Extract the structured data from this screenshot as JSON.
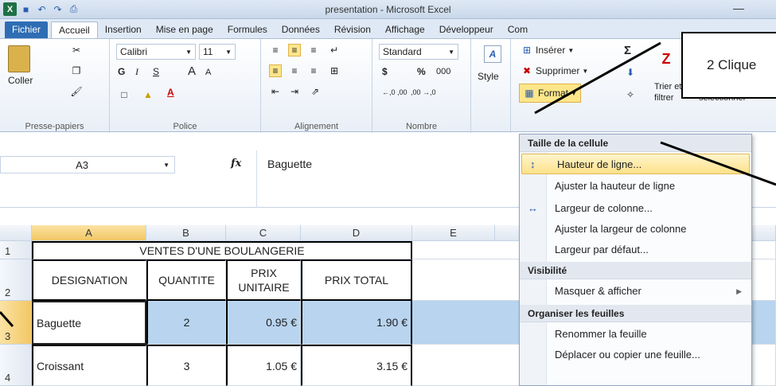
{
  "window": {
    "title": "presentation - Microsoft Excel",
    "minimize_glyph": "—"
  },
  "qat": {
    "logo_letter": "X",
    "save_icon": "save-icon",
    "undo_icon": "undo-icon",
    "redo_icon": "redo-icon"
  },
  "tabs": [
    "Fichier",
    "Accueil",
    "Insertion",
    "Mise en page",
    "Formules",
    "Données",
    "Révision",
    "Affichage",
    "Développeur",
    "Com"
  ],
  "ribbon": {
    "clipboard": {
      "paste": "Coller",
      "group": "Presse-papiers"
    },
    "font": {
      "name": "Calibri",
      "size": "11",
      "bold": "G",
      "italic": "I",
      "underline": "S",
      "grow": "A",
      "shrink": "A",
      "fontcolor": "A",
      "group": "Police"
    },
    "alignment": {
      "group": "Alignement"
    },
    "number": {
      "format": "Standard",
      "currency": "$",
      "percent": "%",
      "thousands": "000",
      "dec_inc": "←,0 ,00",
      "dec_dec": ",00 →,0",
      "group": "Nombre"
    },
    "style": {
      "label": "Style"
    },
    "cells": {
      "insert": "Insérer",
      "delete": "Supprimer",
      "format": "Format"
    },
    "editing": {
      "sum": "Σ",
      "sort": "Trier et",
      "filter": "filtrer",
      "select": "sélectionner"
    }
  },
  "formula_bar": {
    "name_box": "A3",
    "fx": "fx",
    "value": "Baguette"
  },
  "grid": {
    "columns": [
      "A",
      "B",
      "C",
      "D",
      "E"
    ],
    "rows": [
      "1",
      "2",
      "3",
      "4"
    ],
    "title": "VENTES D'UNE BOULANGERIE",
    "headers": [
      "DESIGNATION",
      "QUANTITE",
      "PRIX\nUNITAIRE",
      "PRIX TOTAL"
    ],
    "header_prix_1": "PRIX",
    "header_prix_2": "UNITAIRE",
    "data": [
      [
        "Baguette",
        "2",
        "0.95 €",
        "1.90 €"
      ],
      [
        "Croissant",
        "3",
        "1.05 €",
        "3.15 €"
      ]
    ]
  },
  "menu": {
    "section_cell_size": "Taille de la cellule",
    "row_height": "Hauteur de ligne...",
    "autofit_row": "Ajuster la hauteur de ligne",
    "col_width": "Largeur de colonne...",
    "autofit_col": "Ajuster la largeur de colonne",
    "default_width": "Largeur par défaut...",
    "section_visibility": "Visibilité",
    "hide_show": "Masquer & afficher",
    "section_organize": "Organiser les feuilles",
    "rename": "Renommer la feuille",
    "move_copy": "Déplacer ou copier une feuille..."
  },
  "callout": {
    "text": "2 Clique"
  },
  "colors": {
    "selection": "#b8d4ef",
    "highlight": "#fde28a",
    "file_tab": "#2e6db4"
  }
}
